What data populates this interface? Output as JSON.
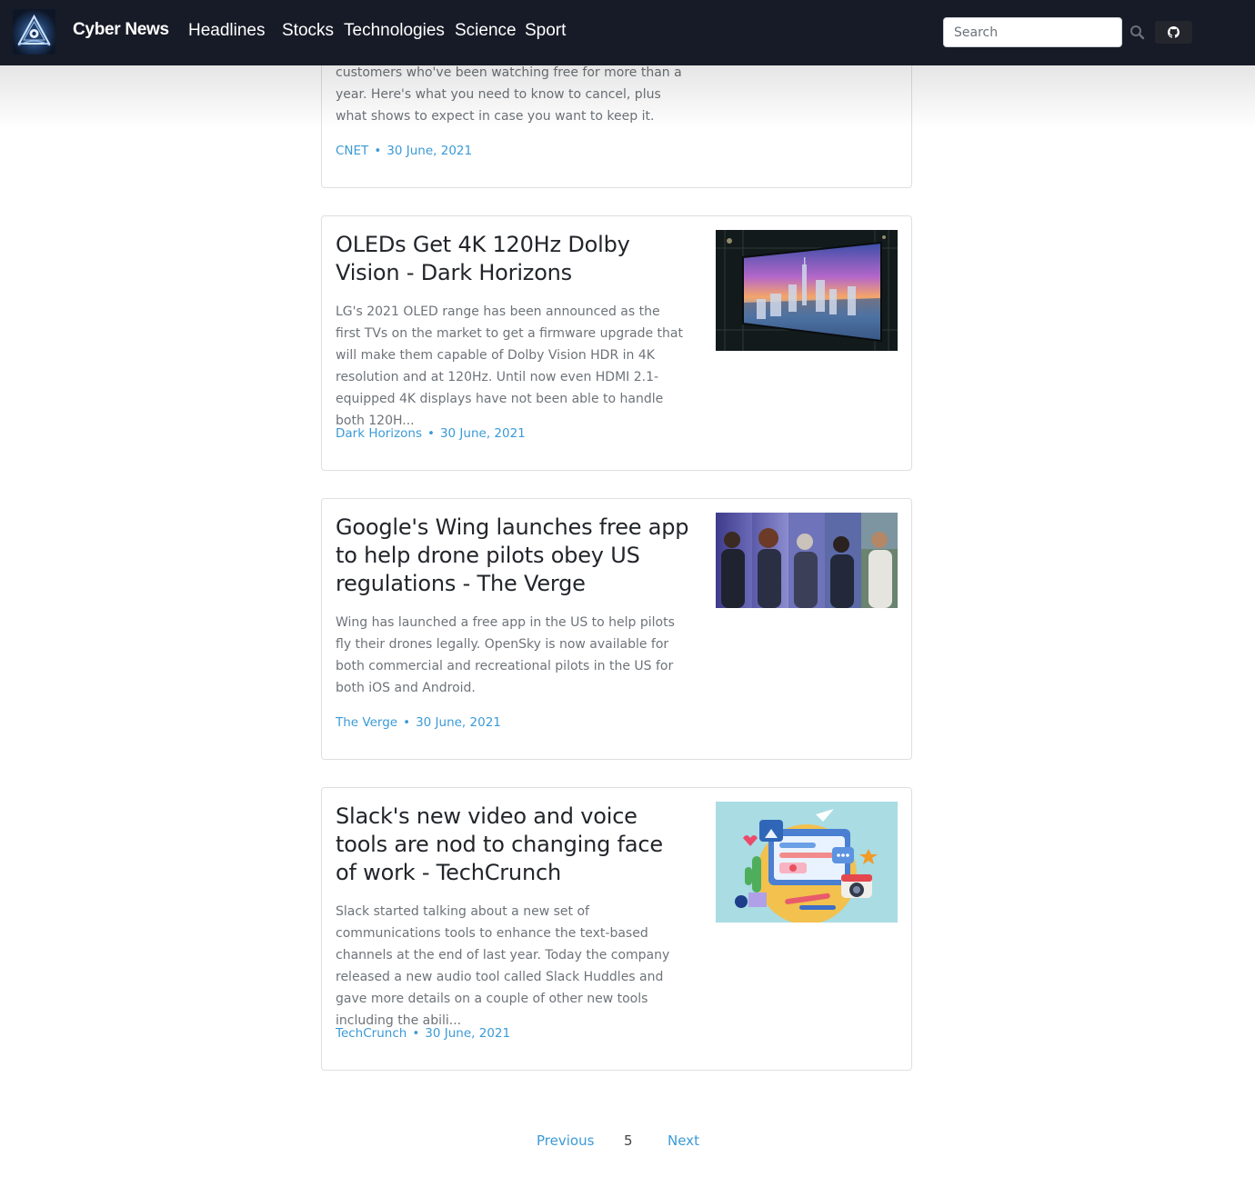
{
  "navbar": {
    "brand": "Cyber News",
    "links": [
      "Headlines",
      "Stocks",
      "Technologies",
      "Science",
      "Sport"
    ],
    "search_placeholder": "Search",
    "colors": {
      "background": "#171b27",
      "text": "#ffffff"
    },
    "icons": {
      "logo": "cyber-news-logo",
      "search": "search-icon",
      "github": "github-icon"
    }
  },
  "articles": [
    {
      "description": "customers who've been watching free for more than a year. Here's what you need to know to cancel, plus what shows to expect in case you want to keep it.",
      "source": "CNET",
      "date": "30 June, 2021"
    },
    {
      "title": "OLEDs Get 4K 120Hz Dolby Vision - Dark Horizons",
      "description": "LG's 2021 OLED range has been announced as the first TVs on the market to get a firmware upgrade that will make them capable of Dolby Vision HDR in 4K resolution and at 120Hz. Until now even HDMI 2.1-equipped 4K displays have not been able to handle both 120H...",
      "source": "Dark Horizons",
      "date": "30 June, 2021",
      "image": "oled-tv-city-skyline"
    },
    {
      "title": "Google's Wing launches free app to help drone pilots obey US regulations - The Verge",
      "description": "Wing has launched a free app in the US to help pilots fly their drones legally. OpenSky is now available for both commercial and recreational pilots in the US for both iOS and Android.",
      "source": "The Verge",
      "date": "30 June, 2021",
      "image": "drone-pilots-collage"
    },
    {
      "title": "Slack's new video and voice tools are nod to changing face of work - TechCrunch",
      "description": "Slack started talking about a new set of communications tools to enhance the text-based channels at the end of last year. Today the company released a new audio tool called Slack Huddles and gave more details on a couple of other new tools including the abili...",
      "source": "TechCrunch",
      "date": "30 June, 2021",
      "image": "communication-apps-illustration"
    }
  ],
  "pagination": {
    "previous": "Previous",
    "current": "5",
    "next": "Next"
  },
  "colors": {
    "link": "#3b9ad6",
    "card_border": "#dddfe2",
    "title": "#22252a",
    "description": "#6e7378"
  }
}
